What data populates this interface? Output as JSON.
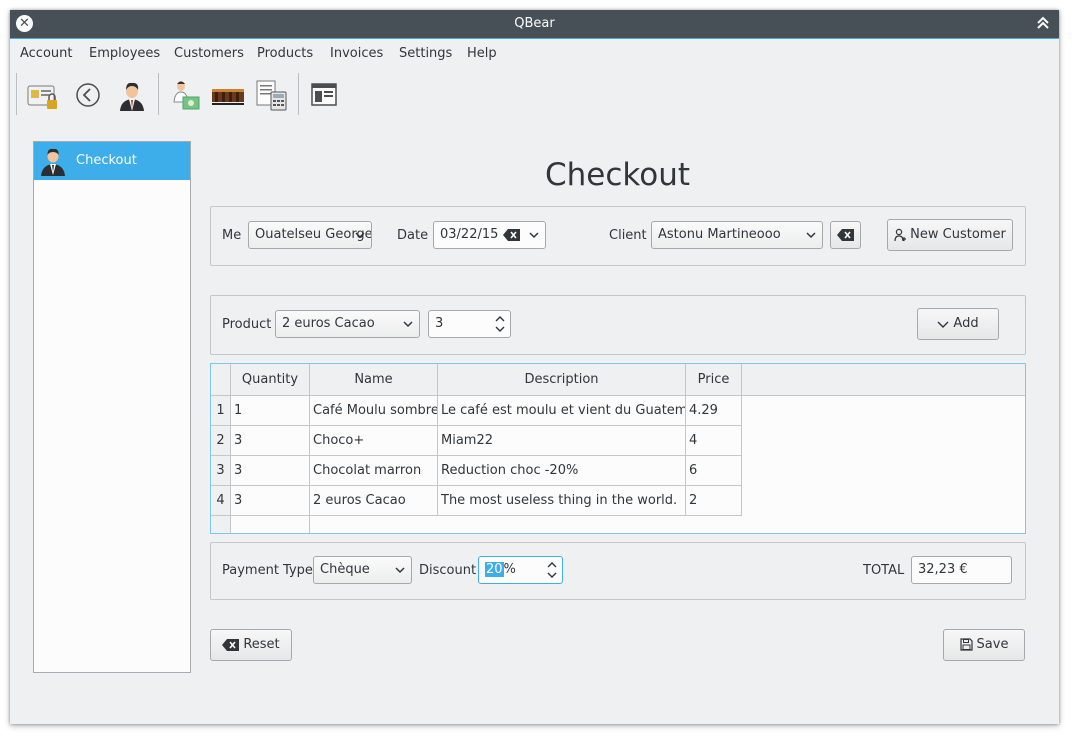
{
  "window": {
    "title": "QBear"
  },
  "menu": [
    "Account",
    "Employees",
    "Customers",
    "Products",
    "Invoices",
    "Settings",
    "Help"
  ],
  "toolbar": {
    "icons": [
      "id-card-lock-icon",
      "back-icon",
      "employee-icon",
      "customer-icon",
      "products-icon",
      "invoices-icon",
      "checkout-icon"
    ]
  },
  "sidebar": {
    "items": [
      {
        "label": "Checkout",
        "icon": "user-icon"
      }
    ]
  },
  "page": {
    "title": "Checkout"
  },
  "header": {
    "me_label": "Me",
    "me_value": "Ouatelseu Georges",
    "date_label": "Date",
    "date_value": "03/22/15",
    "client_label": "Client",
    "client_value": "Astonu Martineooo",
    "new_customer_label": "New Customer"
  },
  "product_row": {
    "product_label": "Product",
    "product_value": "2 euros Cacao",
    "quantity_value": "3",
    "add_label": "Add"
  },
  "table": {
    "columns": [
      "Quantity",
      "Name",
      "Description",
      "Price"
    ],
    "rows": [
      {
        "num": "1",
        "quantity": "1",
        "name": "Café Moulu sombre",
        "description": "Le café est moulu et vient du Guatemala",
        "price": "4.29"
      },
      {
        "num": "2",
        "quantity": "3",
        "name": "Choco+",
        "description": "Miam22",
        "price": "4"
      },
      {
        "num": "3",
        "quantity": "3",
        "name": "Chocolat marron",
        "description": "Reduction choc -20%",
        "price": "6"
      },
      {
        "num": "4",
        "quantity": "3",
        "name": "2 euros Cacao",
        "description": "The most useless thing in the world.",
        "price": "2"
      }
    ]
  },
  "payment": {
    "type_label": "Payment Type",
    "type_value": "Chèque",
    "discount_label": "Discount",
    "discount_value": "20",
    "discount_suffix": "%",
    "total_label": "TOTAL",
    "total_value": "32,23 €"
  },
  "actions": {
    "reset_label": "Reset",
    "save_label": "Save"
  },
  "colors": {
    "accent": "#3daee9",
    "titlebar": "#475057",
    "window_bg": "#eff0f1"
  }
}
